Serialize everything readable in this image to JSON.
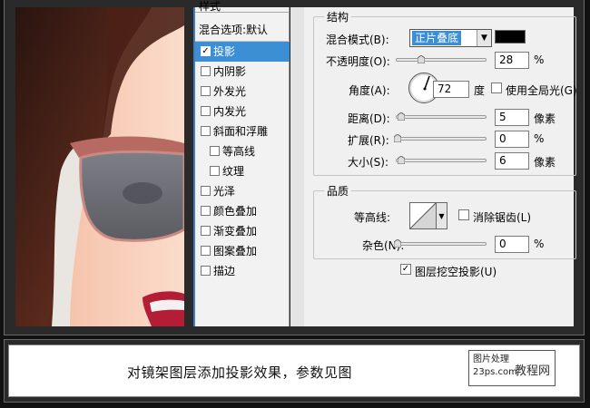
{
  "styles": {
    "header": "样式",
    "blend_options": "混合选项:默认",
    "items": [
      {
        "label": "投影",
        "checked": true,
        "active": true
      },
      {
        "label": "内阴影",
        "checked": false
      },
      {
        "label": "外发光",
        "checked": false
      },
      {
        "label": "内发光",
        "checked": false
      },
      {
        "label": "斜面和浮雕",
        "checked": false
      },
      {
        "label": "等高线",
        "checked": false,
        "sub": true
      },
      {
        "label": "纹理",
        "checked": false,
        "sub": true
      },
      {
        "label": "光泽",
        "checked": false
      },
      {
        "label": "颜色叠加",
        "checked": false
      },
      {
        "label": "渐变叠加",
        "checked": false
      },
      {
        "label": "图案叠加",
        "checked": false
      },
      {
        "label": "描边",
        "checked": false
      }
    ]
  },
  "structure": {
    "title": "结构",
    "blend_mode_label": "混合模式(B):",
    "blend_mode_value": "正片叠底",
    "shadow_color": "#000000",
    "opacity_label": "不透明度(O):",
    "opacity_value": "28",
    "opacity_unit": "%",
    "angle_label": "角度(A):",
    "angle_value": "72",
    "angle_unit": "度",
    "global_light_label": "使用全局光(G)",
    "distance_label": "距离(D):",
    "distance_value": "5",
    "distance_unit": "像素",
    "spread_label": "扩展(R):",
    "spread_value": "0",
    "spread_unit": "%",
    "size_label": "大小(S):",
    "size_value": "6",
    "size_unit": "像素"
  },
  "quality": {
    "title": "品质",
    "contour_label": "等高线:",
    "antialias_label": "消除锯齿(L)",
    "noise_label": "杂色(N):",
    "noise_value": "0",
    "noise_unit": "%"
  },
  "knockout_label": "图层挖空投影(U)",
  "caption": "对镜架图层添加投影效果，参数见图",
  "watermark": {
    "line1": "图片处理",
    "line2": "23ps.com",
    "line3": "教程网"
  },
  "colors": {
    "selection": "#3c8fd5",
    "frame": "#2a2a2a"
  }
}
